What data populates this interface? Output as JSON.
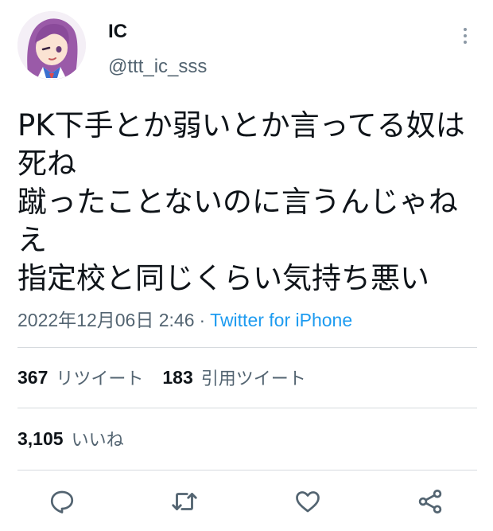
{
  "user": {
    "display_name": "IC",
    "handle": "@ttt_ic_sss",
    "avatar_icon": "anime-character-avatar"
  },
  "more_icon": "more-vertical-icon",
  "tweet": {
    "text": "PK下手とか弱いとか言ってる奴は\n死ね\n蹴ったことないのに言うんじゃね\nえ\n指定校と同じくらい気持ち悪い",
    "timestamp": "2022年12月06日 2:46",
    "separator": "·",
    "source": "Twitter for iPhone"
  },
  "stats": {
    "retweets_count": "367",
    "retweets_label": "リツイート",
    "quotes_count": "183",
    "quotes_label": "引用ツイート",
    "likes_count": "3,105",
    "likes_label": "いいね"
  },
  "actions": [
    "reply-icon",
    "retweet-icon",
    "like-icon",
    "share-icon"
  ],
  "colors": {
    "text_primary": "#0f1419",
    "text_secondary": "#536471",
    "link": "#1d9bf0",
    "divider": "#d6dade",
    "icon": "#536471"
  }
}
